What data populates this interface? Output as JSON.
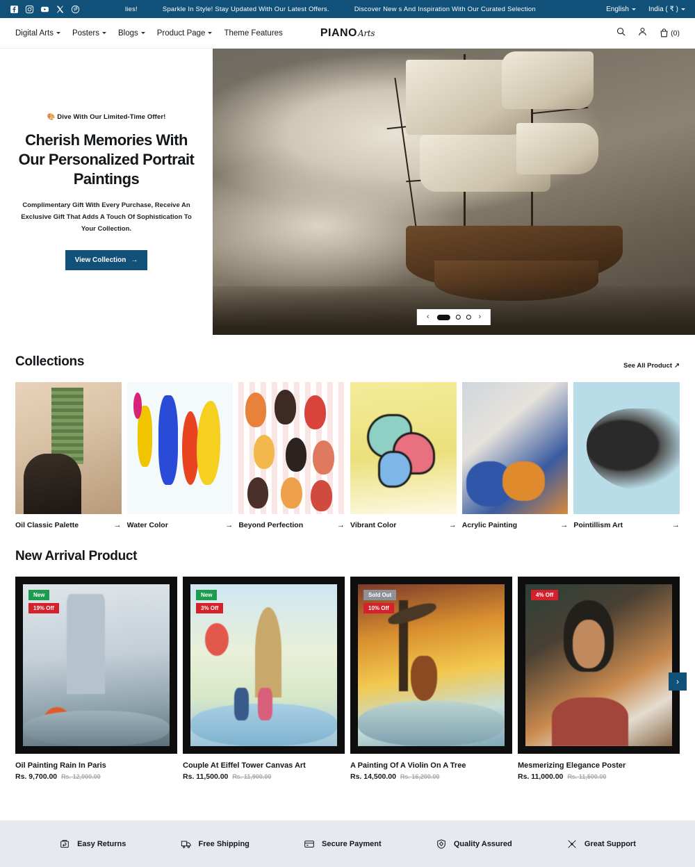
{
  "announcement": {
    "social": [
      "facebook-icon",
      "instagram-icon",
      "youtube-icon",
      "x-icon",
      "pinterest-icon"
    ],
    "messages": [
      "lies!",
      "Sparkle In Style! Stay Updated With Our Latest Offers.",
      "Discover New s And Inspiration With Our Curated Selection"
    ],
    "language": "English",
    "currency": "India ( ₹ )"
  },
  "header": {
    "nav": [
      {
        "label": "Digital Arts",
        "has_dropdown": true
      },
      {
        "label": "Posters",
        "has_dropdown": true
      },
      {
        "label": "Blogs",
        "has_dropdown": true
      },
      {
        "label": "Product Page",
        "has_dropdown": true
      },
      {
        "label": "Theme Features",
        "has_dropdown": false
      }
    ],
    "logo_main": "PIANO",
    "logo_sub": "Arts",
    "cart_count": "(0)"
  },
  "hero": {
    "badge": "🎨 Dive With Our Limited-Time Offer!",
    "title": "Cherish Memories With Our Personalized Portrait Paintings",
    "description": "Complimentary Gift With Every Purchase, Receive An Exclusive Gift That Adds A Touch Of Sophistication To Your Collection.",
    "button": "View Collection",
    "button_arrow": "→",
    "prev_arrow": "‹",
    "next_arrow": "›",
    "slide_count": 3,
    "active_slide": 1
  },
  "collections_section": {
    "title": "Collections",
    "see_all": "See All Product",
    "see_all_arrow": "↗",
    "arrow": "→",
    "items": [
      {
        "name": "Oil Classic Palette"
      },
      {
        "name": "Water Color"
      },
      {
        "name": "Beyond Perfection"
      },
      {
        "name": "Vibrant Color"
      },
      {
        "name": "Acrylic Painting"
      },
      {
        "name": "Pointillism Art"
      }
    ]
  },
  "new_arrivals": {
    "title": "New Arrival Product",
    "next_arrow": "›",
    "products": [
      {
        "title": "Oil Painting Rain In Paris",
        "price": "Rs. 9,700.00",
        "compare_price": "Rs. 12,000.00",
        "badges": [
          {
            "text": "New",
            "type": "new"
          },
          {
            "text": "19% Off",
            "type": "off"
          }
        ]
      },
      {
        "title": "Couple At Eiffel Tower Canvas Art",
        "price": "Rs. 11,500.00",
        "compare_price": "Rs. 11,900.00",
        "badges": [
          {
            "text": "New",
            "type": "new"
          },
          {
            "text": "3% Off",
            "type": "off"
          }
        ]
      },
      {
        "title": "A Painting Of A Violin On A Tree",
        "price": "Rs. 14,500.00",
        "compare_price": "Rs. 16,200.00",
        "badges": [
          {
            "text": "Sold Out",
            "type": "sold"
          },
          {
            "text": "10% Off",
            "type": "off"
          }
        ]
      },
      {
        "title": "Mesmerizing Elegance Poster",
        "price": "Rs. 11,000.00",
        "compare_price": "Rs. 11,500.00",
        "badges": [
          {
            "text": "4% Off",
            "type": "off"
          }
        ]
      }
    ]
  },
  "features": [
    {
      "label": "Easy Returns",
      "icon": "return-box-icon"
    },
    {
      "label": "Free Shipping",
      "icon": "delivery-truck-icon"
    },
    {
      "label": "Secure Payment",
      "icon": "credit-card-icon"
    },
    {
      "label": "Quality Assured",
      "icon": "shield-badge-icon"
    },
    {
      "label": "Great Support",
      "icon": "tools-support-icon"
    }
  ],
  "colors": {
    "brand_blue": "#115179",
    "badge_green": "#1d9b4e",
    "badge_red": "#d5212c",
    "badge_gray": "#8e9298",
    "feature_bar": "#e6eaef"
  }
}
